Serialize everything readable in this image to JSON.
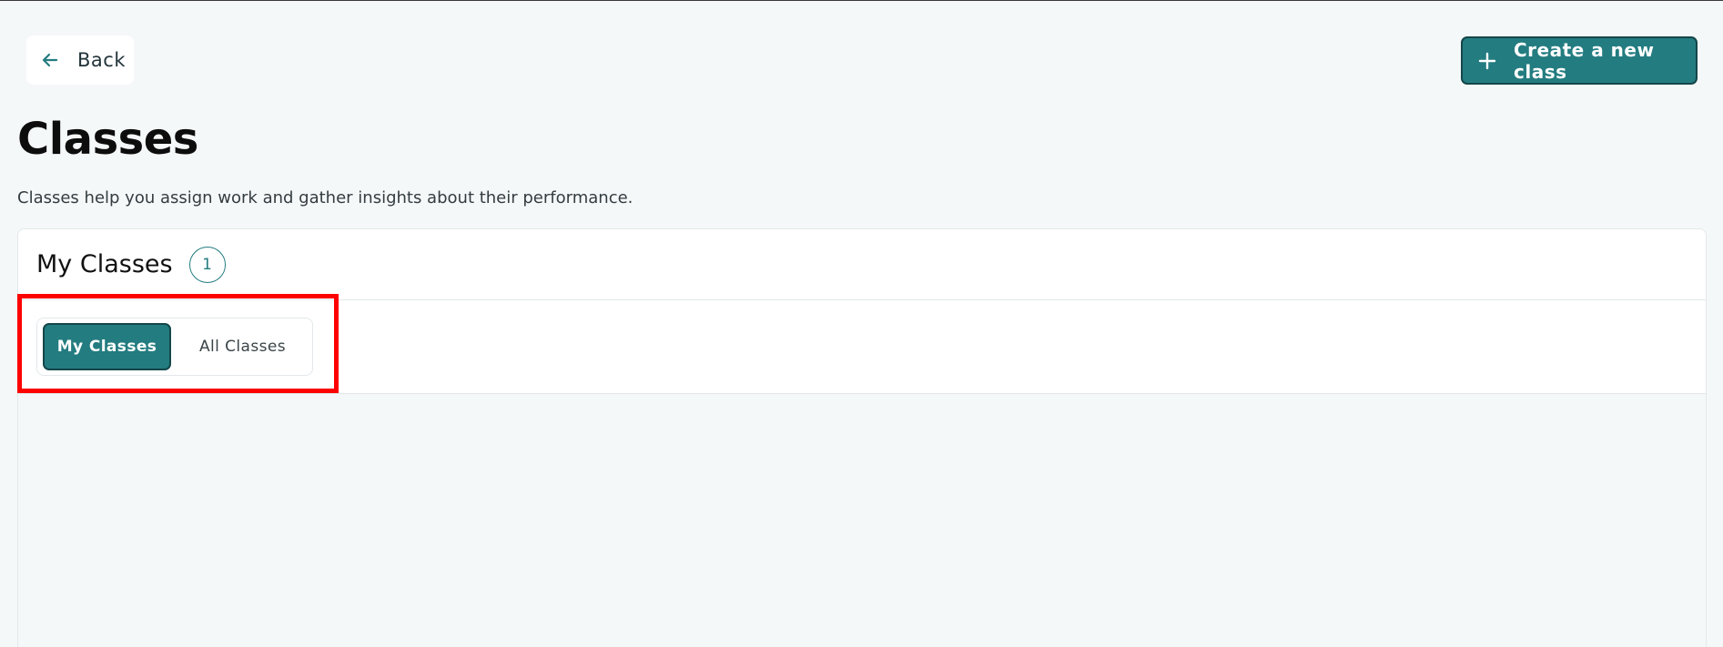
{
  "header": {
    "back_label": "Back",
    "create_label": "Create a new class"
  },
  "page": {
    "title": "Classes",
    "subtitle": "Classes help you assign work and gather insights about their performance."
  },
  "panel": {
    "title": "My Classes",
    "count": "1",
    "toggle": {
      "options": [
        "My Classes",
        "All Classes"
      ],
      "selected": "My Classes"
    }
  },
  "icons": {
    "back": "arrow-left-icon",
    "create": "plus-icon"
  },
  "colors": {
    "accent": "#237c80",
    "accent_border": "#14474a",
    "background": "#f5f8f9",
    "highlight": "#ff0000"
  }
}
